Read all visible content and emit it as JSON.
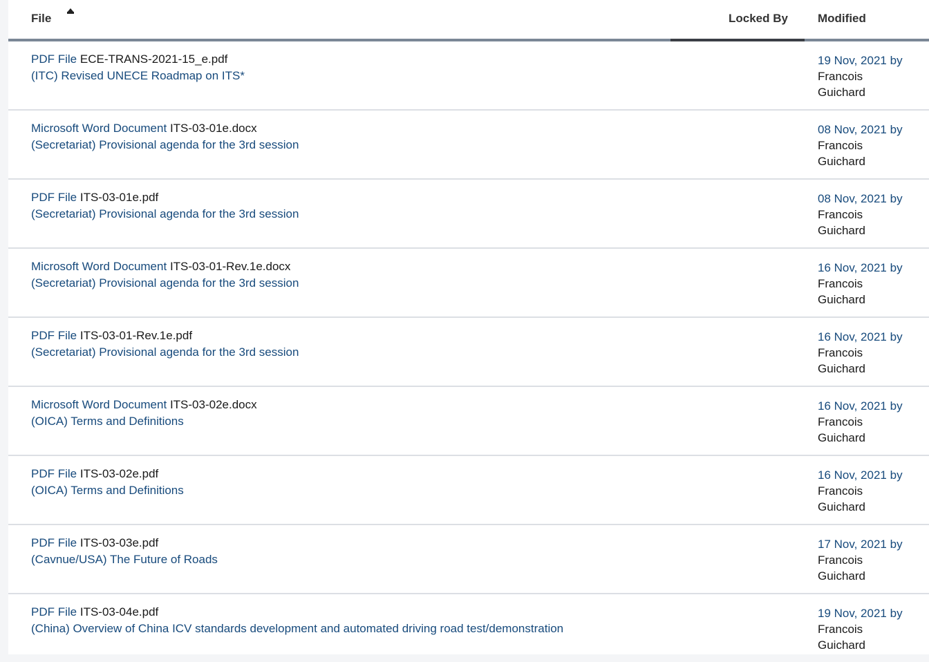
{
  "header": {
    "file_label": "File",
    "locked_by_label": "Locked By",
    "modified_label": "Modified",
    "sort_icon": "sort-up-icon"
  },
  "rows": [
    {
      "type": "PDF File",
      "filename": "ECE-TRANS-2021-15_e.pdf",
      "description": "(ITC) Revised UNECE Roadmap on ITS*",
      "date": "19 Nov, 2021",
      "by": "by",
      "author_first": "Francois",
      "author_last": "Guichard"
    },
    {
      "type": "Microsoft Word Document",
      "filename": "ITS-03-01e.docx",
      "description": "(Secretariat) Provisional agenda for the 3rd session",
      "date": "08 Nov, 2021",
      "by": "by",
      "author_first": "Francois",
      "author_last": "Guichard"
    },
    {
      "type": "PDF File",
      "filename": "ITS-03-01e.pdf",
      "description": "(Secretariat) Provisional agenda for the 3rd session",
      "date": "08 Nov, 2021",
      "by": "by",
      "author_first": "Francois",
      "author_last": "Guichard"
    },
    {
      "type": "Microsoft Word Document",
      "filename": "ITS-03-01-Rev.1e.docx",
      "description": "(Secretariat) Provisional agenda for the 3rd session",
      "date": "16 Nov, 2021",
      "by": "by",
      "author_first": "Francois",
      "author_last": "Guichard"
    },
    {
      "type": "PDF File",
      "filename": "ITS-03-01-Rev.1e.pdf",
      "description": "(Secretariat) Provisional agenda for the 3rd session",
      "date": "16 Nov, 2021",
      "by": "by",
      "author_first": "Francois",
      "author_last": "Guichard"
    },
    {
      "type": "Microsoft Word Document",
      "filename": "ITS-03-02e.docx",
      "description": "(OICA) Terms and Definitions",
      "date": "16 Nov, 2021",
      "by": "by",
      "author_first": "Francois",
      "author_last": "Guichard"
    },
    {
      "type": "PDF File",
      "filename": "ITS-03-02e.pdf",
      "description": "(OICA) Terms and Definitions",
      "date": "16 Nov, 2021",
      "by": "by",
      "author_first": "Francois",
      "author_last": "Guichard"
    },
    {
      "type": "PDF File",
      "filename": "ITS-03-03e.pdf",
      "description": "(Cavnue/USA) The Future of Roads",
      "date": "17 Nov, 2021",
      "by": "by",
      "author_first": "Francois",
      "author_last": "Guichard"
    },
    {
      "type": "PDF File",
      "filename": "ITS-03-04e.pdf",
      "description": "(China) Overview of China ICV standards development and automated driving road test/demonstration",
      "date": "19 Nov, 2021",
      "by": "by",
      "author_first": "Francois",
      "author_last": "Guichard"
    }
  ]
}
